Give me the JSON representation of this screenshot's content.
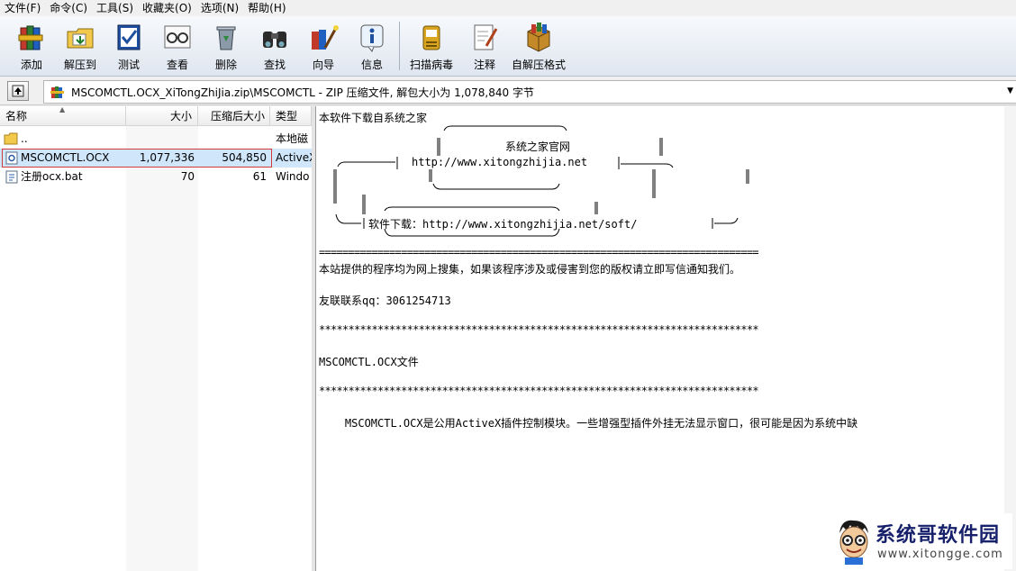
{
  "menu": [
    "文件(F)",
    "命令(C)",
    "工具(S)",
    "收藏夹(O)",
    "选项(N)",
    "帮助(H)"
  ],
  "toolbar": {
    "add": "添加",
    "extract": "解压到",
    "test": "测试",
    "view": "查看",
    "delete": "删除",
    "find": "查找",
    "wizard": "向导",
    "info": "信息",
    "virus_scan": "扫描病毒",
    "comment": "注释",
    "sfx": "自解压格式"
  },
  "address": {
    "path": "MSCOMCTL.OCX_XiTongZhiJia.zip\\MSCOMCTL - ZIP 压缩文件, 解包大小为 1,078,840 字节"
  },
  "file_list": {
    "columns": {
      "name": "名称",
      "size": "大小",
      "packed": "压缩后大小",
      "type": "类型"
    },
    "rows": [
      {
        "name": "..",
        "size": "",
        "packed": "",
        "type": "本地磁"
      },
      {
        "name": "MSCOMCTL.OCX",
        "size": "1,077,336",
        "packed": "504,850",
        "type": "ActiveX"
      },
      {
        "name": "注册ocx.bat",
        "size": "70",
        "packed": "61",
        "type": "Windo"
      }
    ]
  },
  "comment": {
    "line1": "本软件下载自系统之家",
    "box_title": "系统之家官网",
    "box_url": "http://www.xitongzhijia.net",
    "soft_line": "软件下载：http://www.xitongzhijia.net/soft/",
    "equals": "===========================================================================",
    "notice": "本站提供的程序均为网上搜集，如果该程序涉及或侵害到您的版权请立即写信通知我们。",
    "contact": "友联联系qq：3061254713",
    "stars": "***************************************************************************",
    "file_title": "MSCOMCTL.OCX文件",
    "desc": "    MSCOMCTL.OCX是公用ActiveX插件控制模块。一些增强型插件外挂无法显示窗口，很可能是因为系统中缺"
  },
  "watermark": {
    "name": "系统哥软件园",
    "url": "www.xitongge.com"
  }
}
